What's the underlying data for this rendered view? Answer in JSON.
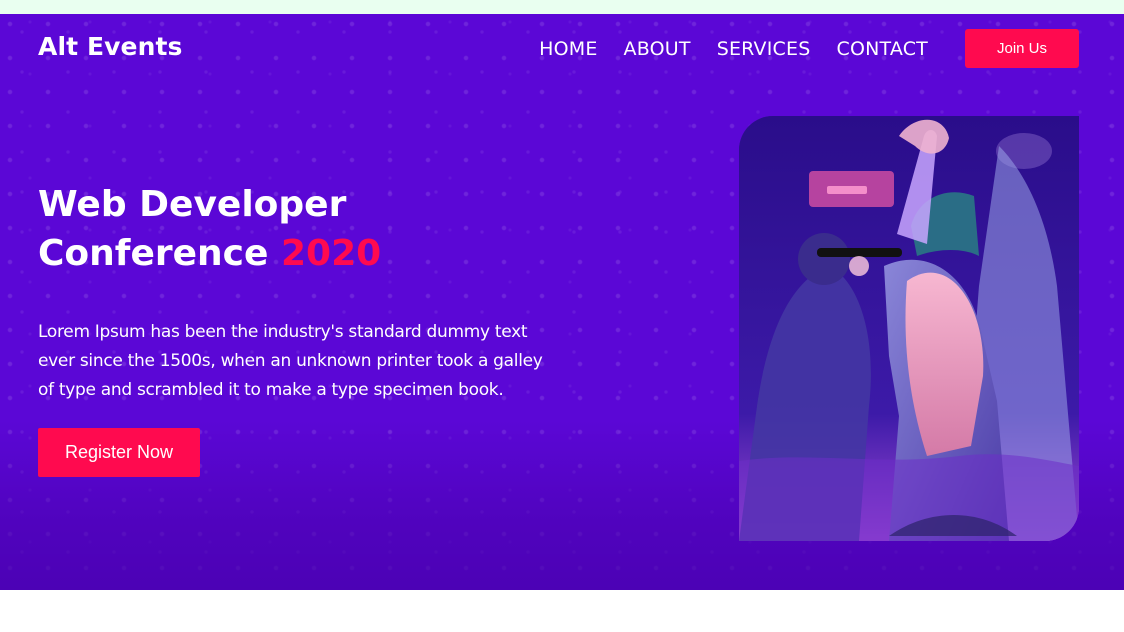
{
  "nav": {
    "logo": "Alt Events",
    "links": [
      "HOME",
      "ABOUT",
      "SERVICES",
      "CONTACT"
    ],
    "join_label": "Join Us"
  },
  "hero": {
    "title_line1": "Web Developer",
    "title_line2_prefix": "Conference",
    "title_year": "2020",
    "description": "Lorem Ipsum has been the industry's standard dummy text ever since the 1500s, when an unknown printer took a galley of type and scrambled it to make a type specimen book.",
    "cta_label": "Register Now"
  },
  "colors": {
    "hero_bg": "#5b07d6",
    "accent": "#ff0a4f",
    "top_strip": "#e9fff0"
  },
  "icons": {
    "photo": "concert-singer-image"
  }
}
